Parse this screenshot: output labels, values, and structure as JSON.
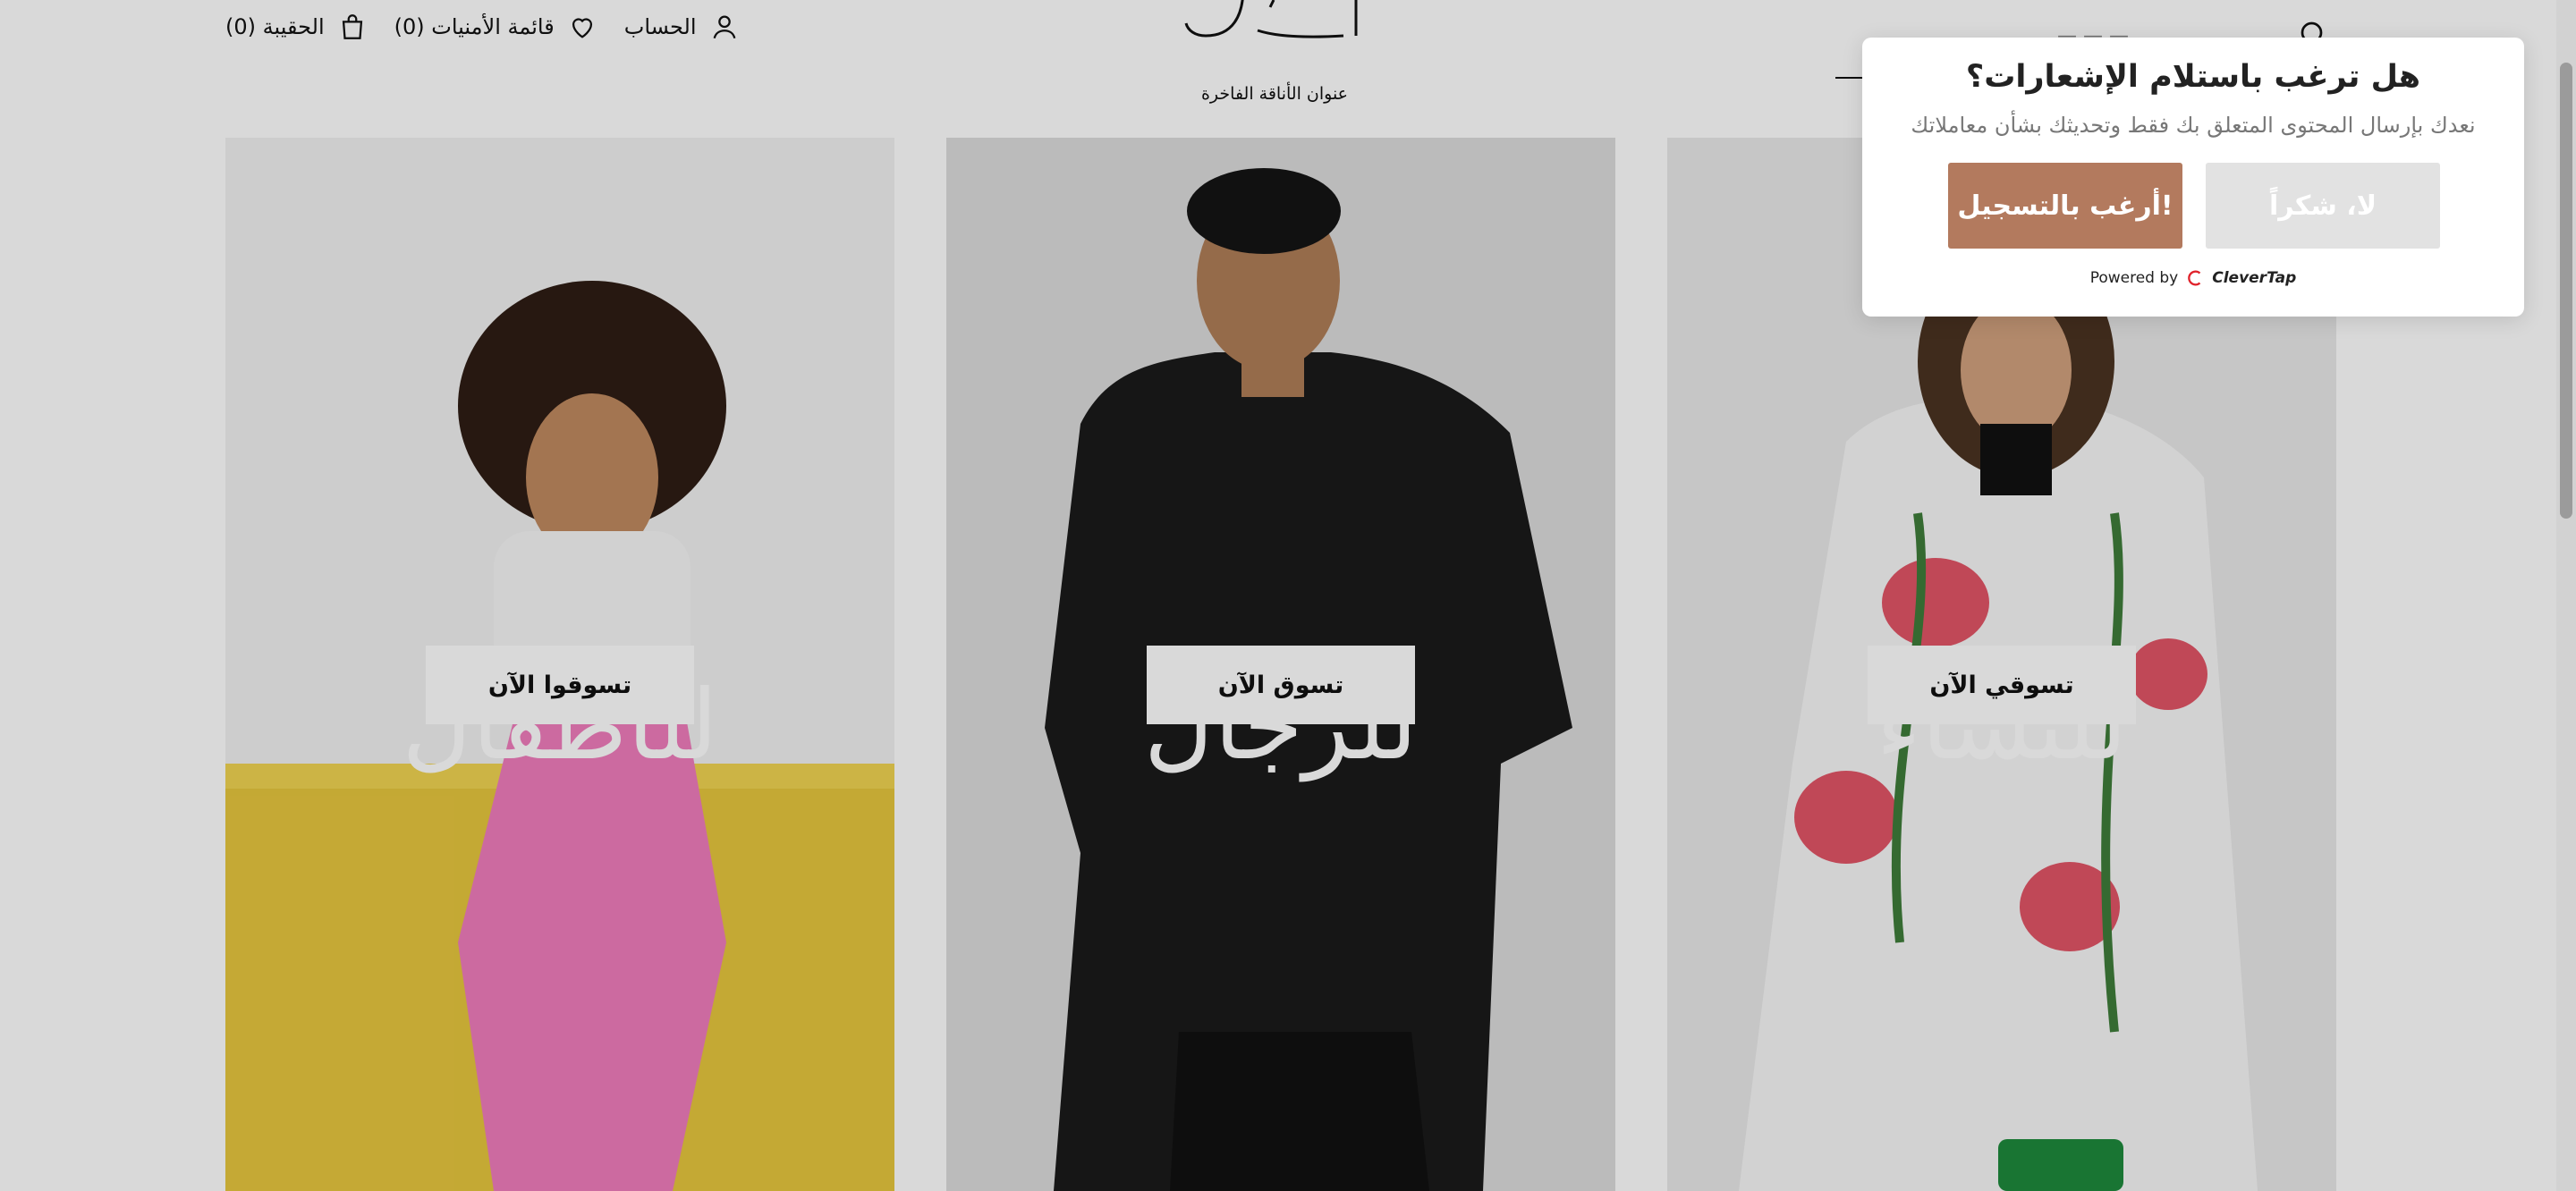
{
  "header": {
    "bag_label": "الحقيبة (0)",
    "wishlist_label": "قائمة الأمنيات (0)",
    "account_label": "الحساب",
    "tagline": "عنوان الأناقة الفاخرة"
  },
  "categories": [
    {
      "title": "للأطفال",
      "button": "تسوقوا الآن"
    },
    {
      "title": "للرجال",
      "button": "تسوق الآن"
    },
    {
      "title": "للنساء",
      "button": "تسوقي الآن"
    }
  ],
  "popup": {
    "title": "هل ترغب باستلام الإشعارات؟",
    "description": "نعدك بإرسال المحتوى المتعلق بك فقط وتحديثك بشأن معاملاتك",
    "yes_button": "أرغب بالتسجيل!",
    "no_button": "لا، شكراً",
    "powered_by": "Powered by",
    "brand": "CleverTap"
  },
  "colors": {
    "accent_button": "#b37a5e",
    "disabled_button": "#e2e2e2",
    "overlay": "rgba(0,0,0,0.15)"
  },
  "icons": {
    "bag": "bag-icon",
    "wishlist": "heart-icon",
    "account": "user-icon",
    "search": "search-icon"
  }
}
